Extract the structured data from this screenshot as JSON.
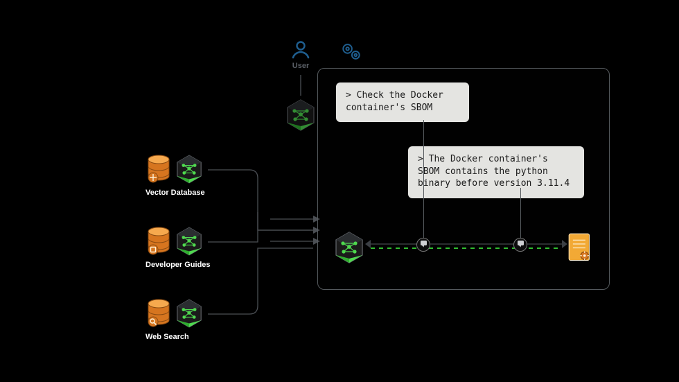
{
  "top": {
    "user_label": "User"
  },
  "sources": [
    {
      "label": "Vector Database"
    },
    {
      "label": "Developer Guides"
    },
    {
      "label": "Web Search"
    }
  ],
  "panel": {
    "bubble1": "> Check the Docker container's SBOM",
    "bubble2": "> The Docker container's SBOM contains the python binary before version 3.11.4"
  },
  "icons": {
    "user": "user-icon",
    "gears": "gears-icon",
    "cube": "ai-cube-icon",
    "db": "database-icon",
    "file": "document-gear-icon",
    "msg": "message-icon"
  },
  "colors": {
    "accent_green": "#4fd94f",
    "accent_orange": "#f08a2a",
    "bubble_bg": "#e4e4e1",
    "panel_border": "#555a5e"
  }
}
